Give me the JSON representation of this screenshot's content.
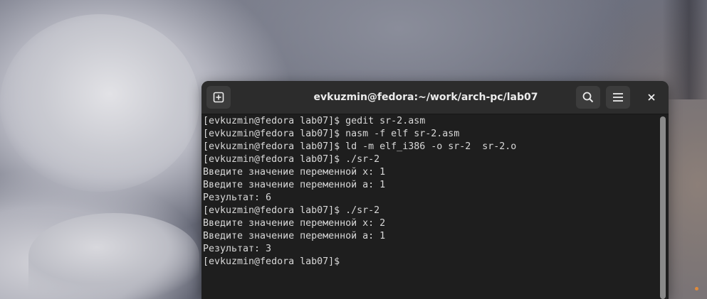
{
  "window": {
    "title": "evkuzmin@fedora:~/work/arch-pc/lab07"
  },
  "icons": {
    "new_tab": "new-tab-icon",
    "search": "search-icon",
    "menu": "hamburger-menu-icon",
    "close": "close-icon"
  },
  "terminal": {
    "lines": [
      "[evkuzmin@fedora lab07]$ gedit sr-2.asm",
      "[evkuzmin@fedora lab07]$ nasm -f elf sr-2.asm",
      "[evkuzmin@fedora lab07]$ ld -m elf_i386 -o sr-2  sr-2.o",
      "[evkuzmin@fedora lab07]$ ./sr-2",
      "Введите значение переменной x: 1",
      "Введите значение переменной a: 1",
      "Результат: 6",
      "[evkuzmin@fedora lab07]$ ./sr-2",
      "Введите значение переменной x: 2",
      "Введите значение переменной a: 1",
      "Результат: 3",
      "[evkuzmin@fedora lab07]$ "
    ]
  },
  "colors": {
    "terminal_bg": "#1e1e1e",
    "titlebar_bg": "#2c2c2c",
    "text": "#d8d8d8"
  }
}
